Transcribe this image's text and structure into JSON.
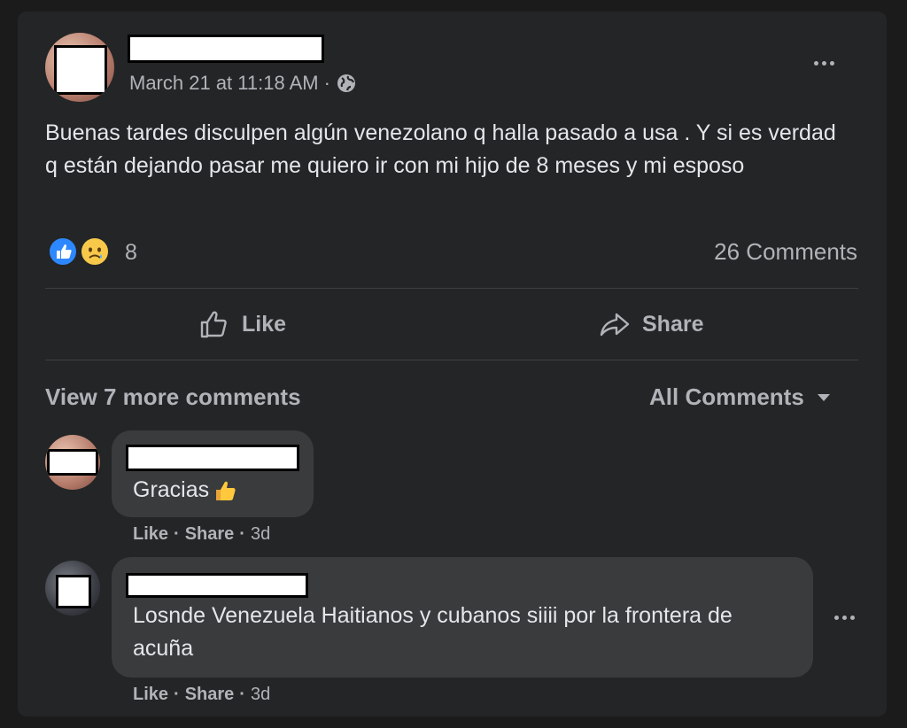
{
  "post": {
    "timestamp": "March 21 at 11:18 AM",
    "separator": "·",
    "body": "Buenas tardes disculpen algún venezolano q halla pasado a usa . Y si es verdad q están dejando pasar me quiero ir con mi hijo de 8 meses y mi esposo",
    "reaction_count": "8",
    "comment_count": "26 Comments"
  },
  "actions": {
    "like_label": "Like",
    "share_label": "Share"
  },
  "comments_bar": {
    "view_more": "View 7 more comments",
    "filter": "All Comments"
  },
  "comments": [
    {
      "text": "Gracias",
      "like": "Like",
      "share": "Share",
      "sep": "·",
      "time": "3d"
    },
    {
      "text": "Losnde Venezuela Haitianos y cubanos siiii por la frontera de acuña",
      "like": "Like",
      "share": "Share",
      "sep": "·",
      "time": "3d"
    }
  ],
  "icons": {
    "reaction_like": "like-reaction-icon",
    "reaction_sad": "sad-reaction-icon",
    "privacy": "globe-icon",
    "more": "more-options-icon",
    "thumbs_up_emoji": "thumbs-up-emoji-icon"
  },
  "colors": {
    "card_bg": "#242526",
    "bubble_bg": "#3a3b3c",
    "primary_text": "#e4e6eb",
    "secondary_text": "#b0b3b8",
    "like_blue": "#2d88ff",
    "sad_yellow": "#f7c84a"
  }
}
